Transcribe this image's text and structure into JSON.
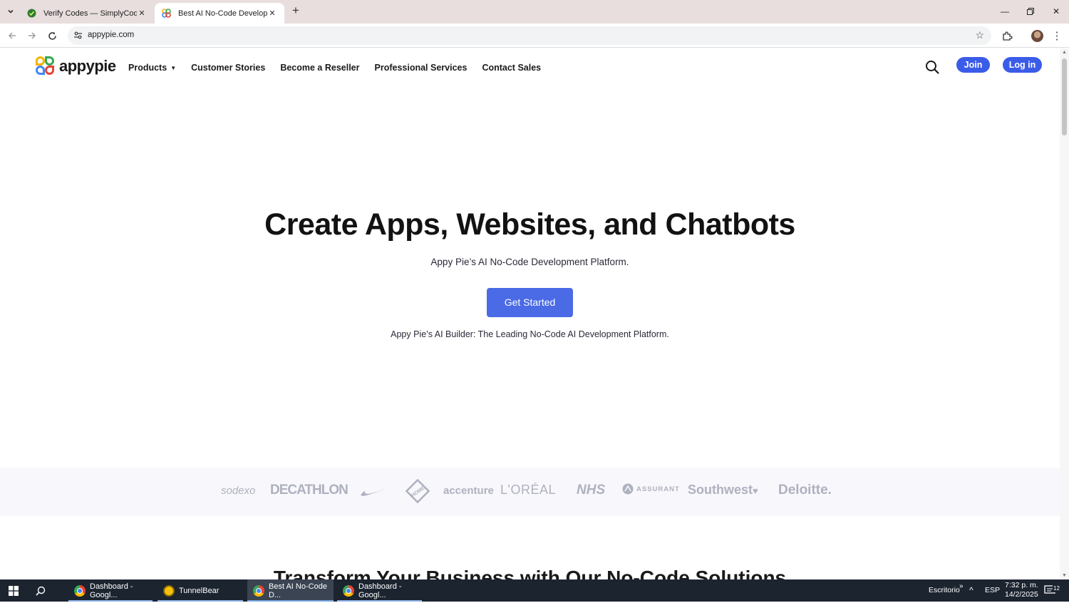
{
  "browser": {
    "tabs": [
      {
        "title": "Verify Codes — SimplyCodes",
        "active": false
      },
      {
        "title": "Best AI No-Code Development",
        "active": true
      }
    ],
    "new_tab_icon": "plus-icon",
    "url": "appypie.com"
  },
  "site": {
    "logo_text": "appypie",
    "nav": [
      {
        "label": "Products",
        "has_dropdown": true
      },
      {
        "label": "Customer Stories"
      },
      {
        "label": "Become a Reseller"
      },
      {
        "label": "Professional Services"
      },
      {
        "label": "Contact Sales"
      }
    ],
    "join_label": "Join",
    "login_label": "Log in",
    "accent_color": "#3b5ce8"
  },
  "hero": {
    "title": "Create Apps, Websites, and Chatbots",
    "subtitle": "Appy Pie’s AI No-Code Development Platform.",
    "cta_label": "Get Started",
    "note": "Appy Pie’s AI Builder: The Leading No-Code AI Development Platform."
  },
  "brands": [
    "sodexo",
    "DECATHLON",
    "nike-swoosh",
    "THE HOME DEPOT",
    "accenture",
    "L'ORÉAL",
    "NHS",
    "ASSURANT",
    "Southwest",
    "Deloitte."
  ],
  "section_title": "Transform Your Business with Our No-Code Solutions",
  "taskbar": {
    "apps": [
      {
        "label": "Dashboard - Googl..."
      },
      {
        "label": "TunnelBear"
      },
      {
        "label": "Best AI No-Code D..."
      },
      {
        "label": "Dashboard - Googl..."
      }
    ],
    "desktop_label": "Escritorio",
    "language": "ESP",
    "time": "7:32 p. m.",
    "date": "14/2/2025",
    "notification_count": "12"
  }
}
